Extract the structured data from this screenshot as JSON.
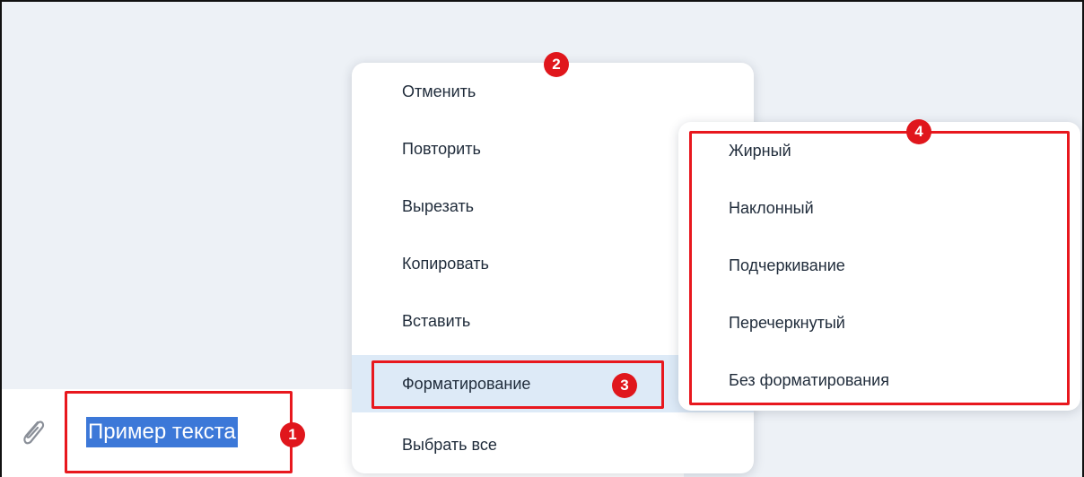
{
  "composer": {
    "input_text": "Пример текста",
    "attach_icon": "paperclip-icon"
  },
  "context_menu": {
    "items": [
      {
        "label": "Отменить"
      },
      {
        "label": "Повторить"
      },
      {
        "label": "Вырезать"
      },
      {
        "label": "Копировать"
      },
      {
        "label": "Вставить"
      },
      {
        "label": "Форматирование"
      },
      {
        "label": "Выбрать все"
      }
    ]
  },
  "format_submenu": {
    "items": [
      {
        "label": "Жирный"
      },
      {
        "label": "Наклонный"
      },
      {
        "label": "Подчеркивание"
      },
      {
        "label": "Перечеркнутый"
      },
      {
        "label": "Без форматирования"
      }
    ]
  },
  "annotations": {
    "badge_1": "1",
    "badge_2": "2",
    "badge_3": "3",
    "badge_4": "4",
    "color": "#e0161c"
  },
  "colors": {
    "background": "#edf1f6",
    "selection": "#3c78d8",
    "active_item": "#ddeaf7"
  }
}
